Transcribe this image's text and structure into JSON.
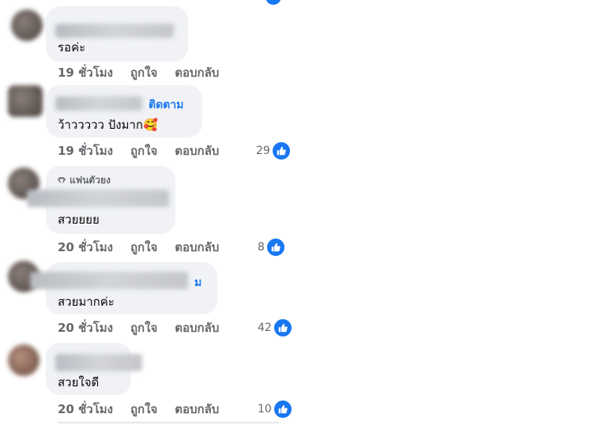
{
  "comments": [
    {
      "text": "รอค่ะ",
      "time": "19 ชั่วโมง",
      "like": "ถูกใจ",
      "reply": "ตอบกลับ",
      "reactions": null
    },
    {
      "follow": "ติดตาม",
      "text": "ว้าววววว ปังมาก",
      "emoji": "🥰",
      "time": "19 ชั่วโมง",
      "like": "ถูกใจ",
      "reply": "ตอบกลับ",
      "reactions": "29"
    },
    {
      "badge": "แฟนตัวยง",
      "text": "สวยยยย",
      "time": "20 ชั่วโมง",
      "like": "ถูกใจ",
      "reply": "ตอบกลับ",
      "reactions": "8"
    },
    {
      "follow": "ม",
      "text": "สวยมากค่ะ",
      "time": "20 ชั่วโมง",
      "like": "ถูกใจ",
      "reply": "ตอบกลับ",
      "reactions": "42"
    },
    {
      "text": "สวยใจดี",
      "time": "20 ชั่วโมง",
      "like": "ถูกใจ",
      "reply": "ตอบกลับ",
      "reactions": "10"
    }
  ],
  "icons": {
    "reaction": "like-thumb-icon",
    "badge": "diamond-icon"
  },
  "colors": {
    "accent": "#1877f2",
    "bubble": "#f0f2f5",
    "meta": "#65676b"
  }
}
